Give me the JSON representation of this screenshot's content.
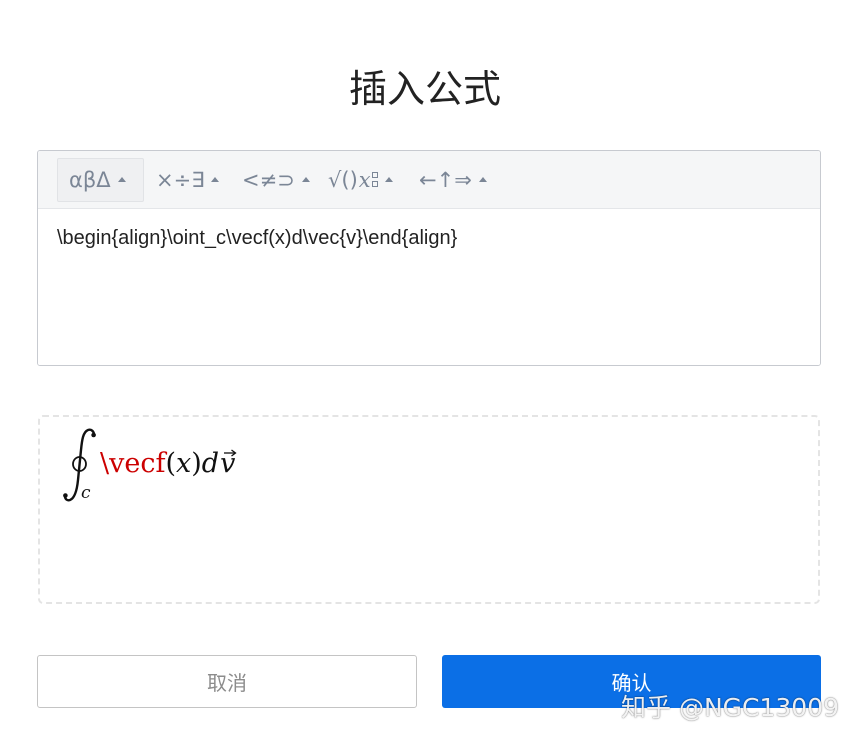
{
  "dialog": {
    "title": "插入公式"
  },
  "toolbar": {
    "groups": [
      {
        "label": "αβΔ",
        "icon": "caret-up-icon",
        "active": true
      },
      {
        "label": "×÷∃",
        "icon": "caret-up-icon",
        "active": false
      },
      {
        "label": "<≠⊃",
        "icon": "caret-up-icon",
        "active": false
      },
      {
        "label": "√()",
        "variable": "x",
        "icon": "caret-up-icon",
        "active": false
      },
      {
        "label": "←↑⇒",
        "icon": "caret-up-icon",
        "active": false
      }
    ]
  },
  "editor": {
    "value": "\\begin{align}\\oint_c\\vecf(x)d\\vec{v}\\end{align}"
  },
  "preview": {
    "integral_icon": "contour-integral-icon",
    "subscript": "c",
    "error_token": "\\vecf",
    "tokens": [
      "(",
      "x",
      ")",
      "d"
    ],
    "vector_variable": "v"
  },
  "buttons": {
    "cancel": "取消",
    "confirm": "确认"
  },
  "watermark": "知乎 @NGC13009",
  "colors": {
    "accent": "#0b6fe6",
    "error": "#cc0000",
    "toolbar_text": "#7b8696",
    "text": "#222222"
  }
}
